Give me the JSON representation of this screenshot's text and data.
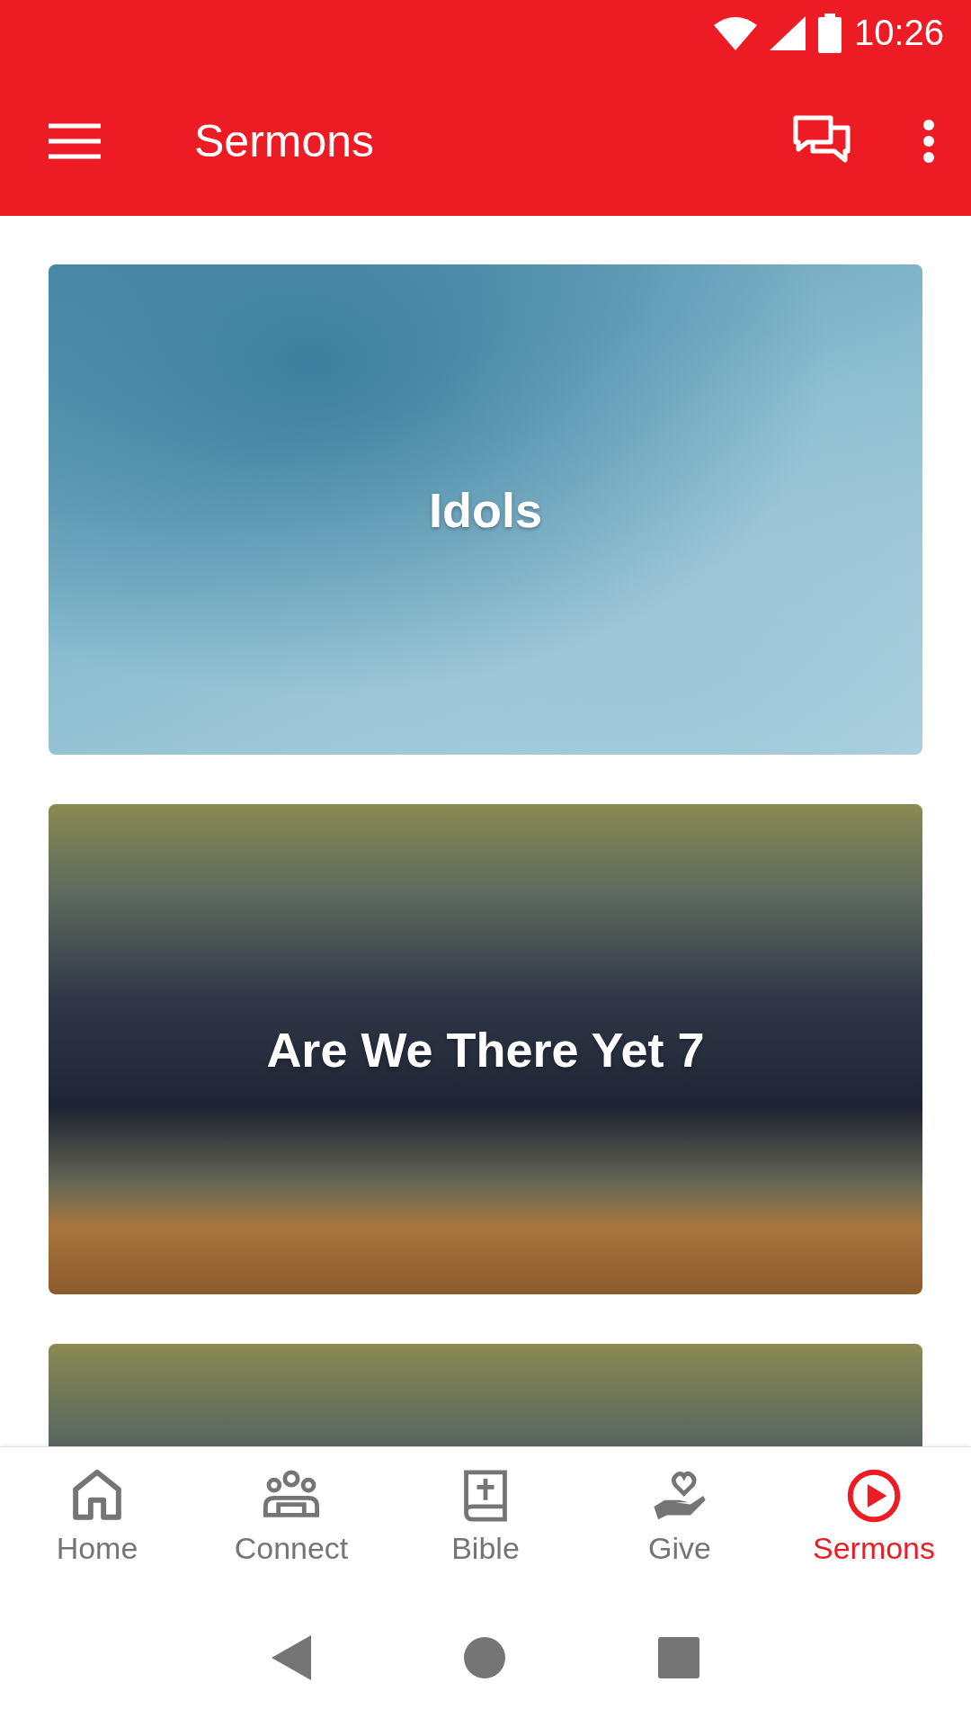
{
  "status_bar": {
    "time": "10:26"
  },
  "app_bar": {
    "title": "Sermons"
  },
  "sermons": [
    {
      "title": "Idols",
      "kind": "water"
    },
    {
      "title": "Are We There Yet 7",
      "kind": "storm"
    },
    {
      "kind": "storm"
    }
  ],
  "bottom_nav": [
    {
      "label": "Home",
      "kind": "home",
      "selected": false
    },
    {
      "label": "Connect",
      "kind": "people",
      "selected": false
    },
    {
      "label": "Bible",
      "kind": "bible",
      "selected": false
    },
    {
      "label": "Give",
      "kind": "give",
      "selected": false
    },
    {
      "label": "Sermons",
      "kind": "play",
      "selected": true
    }
  ]
}
